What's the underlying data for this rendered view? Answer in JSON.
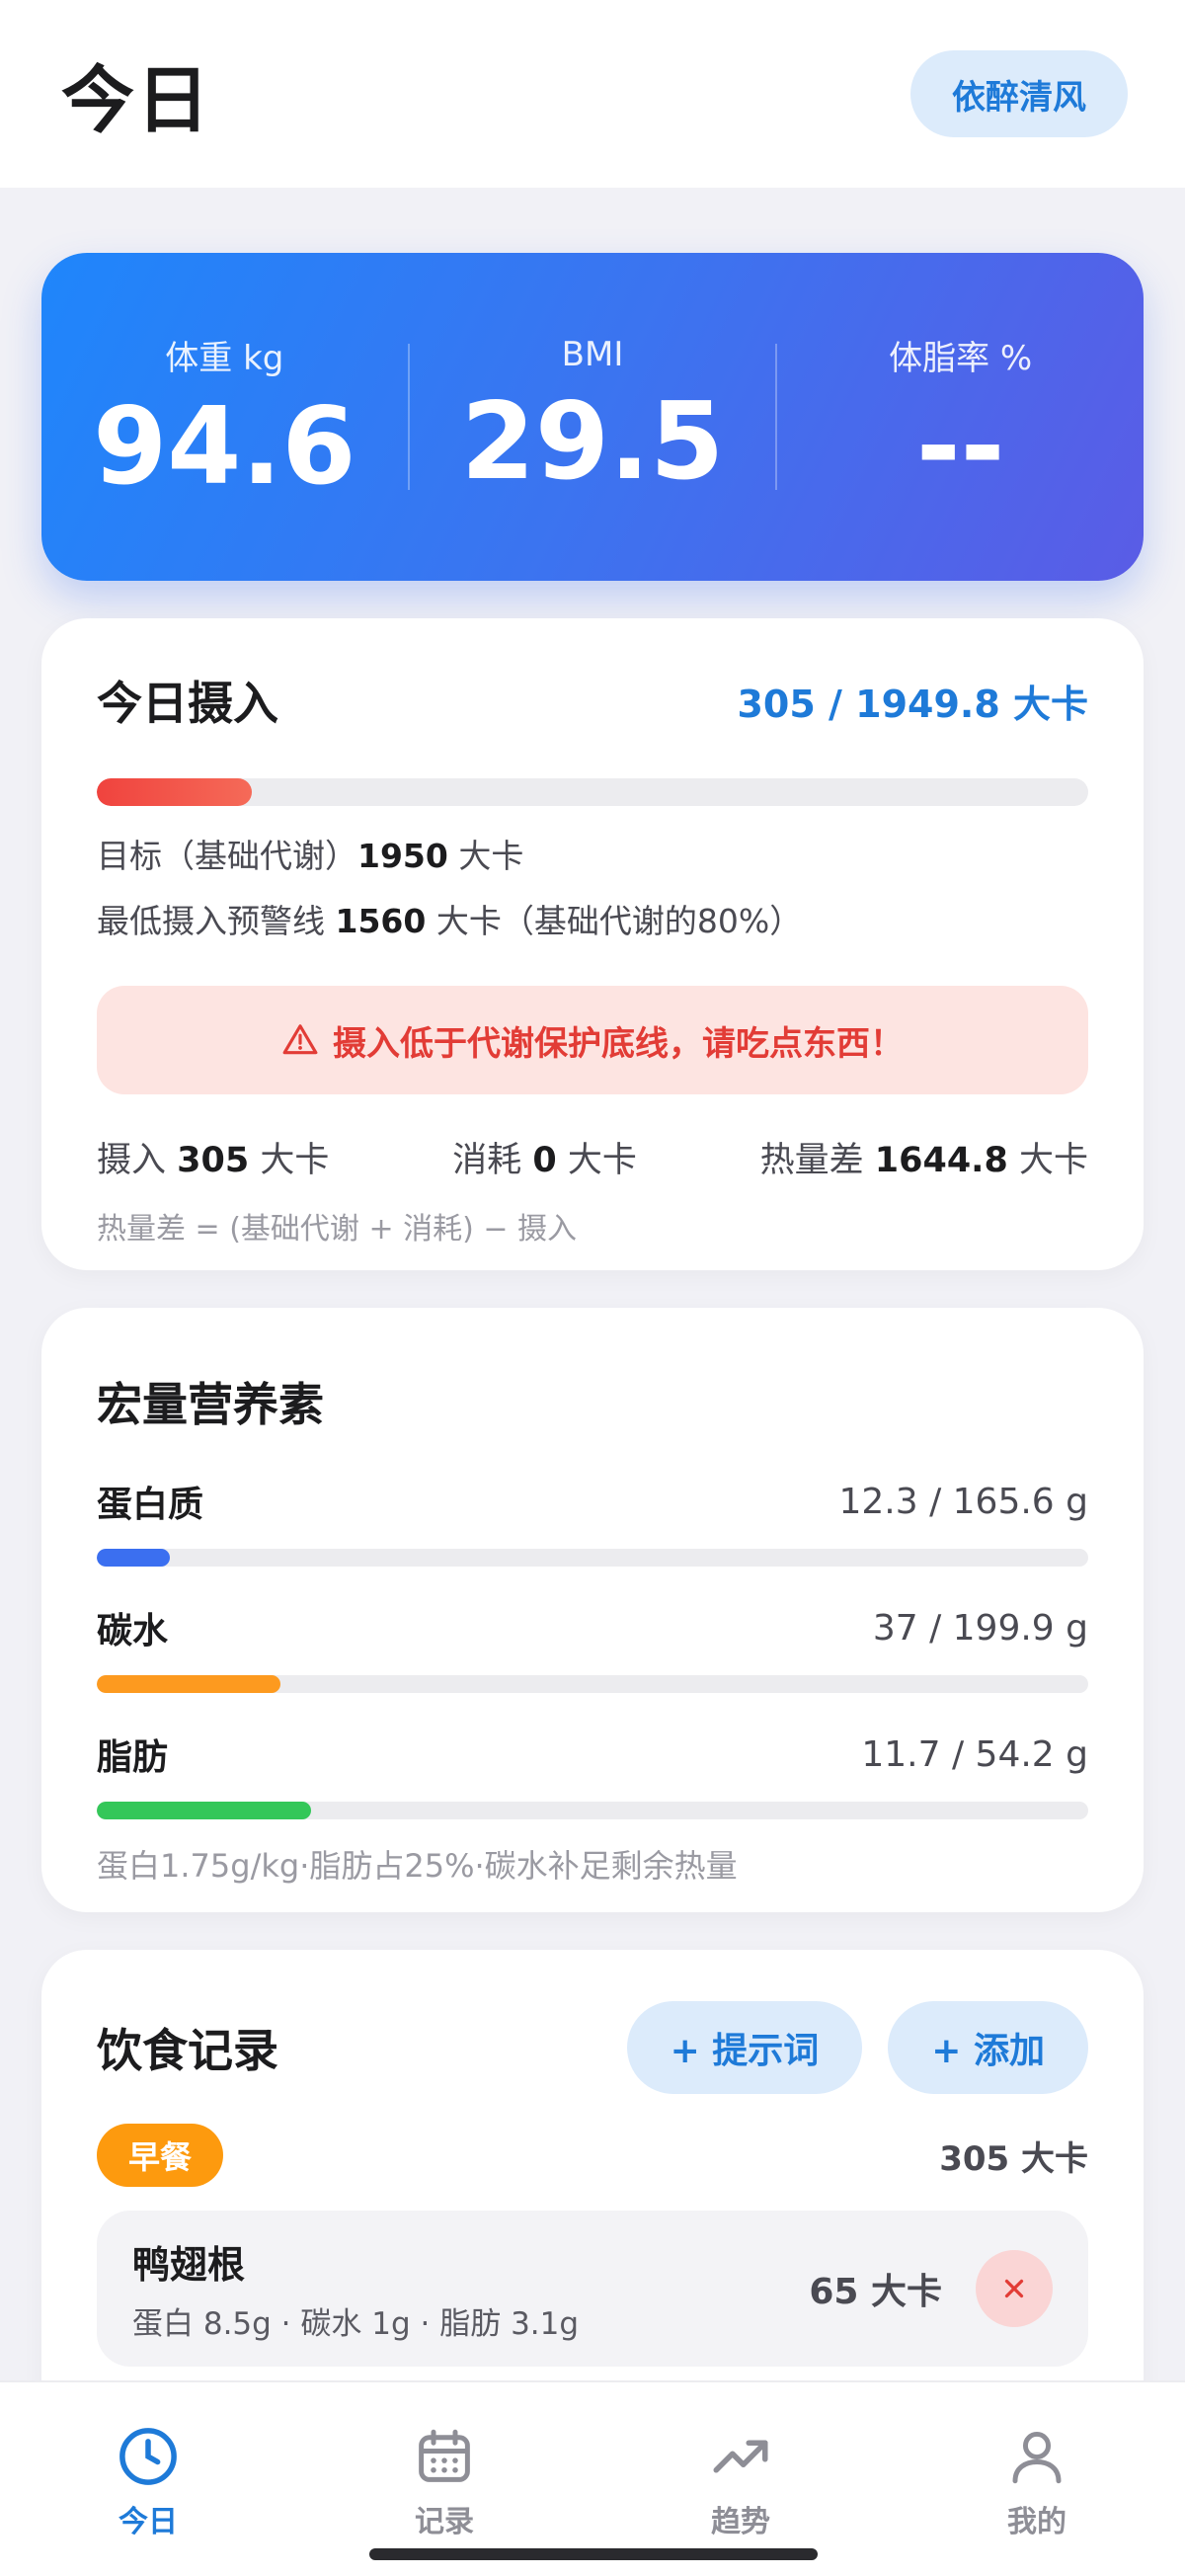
{
  "header": {
    "title": "今日",
    "user_name": "依醉清风"
  },
  "stats": [
    {
      "label": "体重 kg",
      "value": "94.6"
    },
    {
      "label": "BMI",
      "value": "29.5"
    },
    {
      "label": "体脂率 %",
      "value": "--"
    }
  ],
  "intake": {
    "title": "今日摄入",
    "summary": "305 / 1949.8 大卡",
    "progress": 0.156,
    "target_prefix": "目标（基础代谢）",
    "target_value": "1950",
    "target_unit": "大卡",
    "min_prefix": "最低摄入预警线",
    "min_value": "1560",
    "min_suffix": "大卡（基础代谢的80%）",
    "alert_text": "摄入低于代谢保护底线，请吃点东西！",
    "intake_label": "摄入",
    "intake_value": "305",
    "burn_label": "消耗",
    "burn_value": "0",
    "deficit_label": "热量差",
    "deficit_value": "1644.8",
    "unit": "大卡",
    "formula": "热量差 = (基础代谢 + 消耗) − 摄入",
    "colors": {
      "bar": "#f0433e",
      "alert_bg": "#fde4e1",
      "alert_text": "#e23c36"
    }
  },
  "macros": {
    "title": "宏量营养素",
    "items": [
      {
        "name": "蛋白质",
        "value": "12.3 / 165.6 g",
        "fraction": 0.074,
        "color": "#3b6ff0"
      },
      {
        "name": "碳水",
        "value": "37 / 199.9 g",
        "fraction": 0.185,
        "color": "#fd9a1f"
      },
      {
        "name": "脂肪",
        "value": "11.7 / 54.2 g",
        "fraction": 0.216,
        "color": "#34c759"
      }
    ],
    "note": "蛋白1.75g/kg·脂肪占25%·碳水补足剩余热量"
  },
  "food_log": {
    "title": "饮食记录",
    "prompt_button": "+ 提示词",
    "add_button": "+ 添加",
    "meals": [
      {
        "name": "早餐",
        "calories": "305 大卡",
        "items": [
          {
            "name": "鸭翅根",
            "macros": "蛋白 8.5g · 碳水 1g · 脂肪 3.1g",
            "calories": "65 大卡"
          }
        ]
      }
    ]
  },
  "tabbar": {
    "active": "today",
    "tabs": [
      {
        "id": "today",
        "label": "今日",
        "icon": "clock-icon"
      },
      {
        "id": "records",
        "label": "记录",
        "icon": "calendar-icon"
      },
      {
        "id": "trends",
        "label": "趋势",
        "icon": "trend-icon"
      },
      {
        "id": "me",
        "label": "我的",
        "icon": "person-icon"
      }
    ]
  },
  "colors": {
    "accent": "#1e7ad8",
    "meal_tag": "#fd9a0e"
  }
}
